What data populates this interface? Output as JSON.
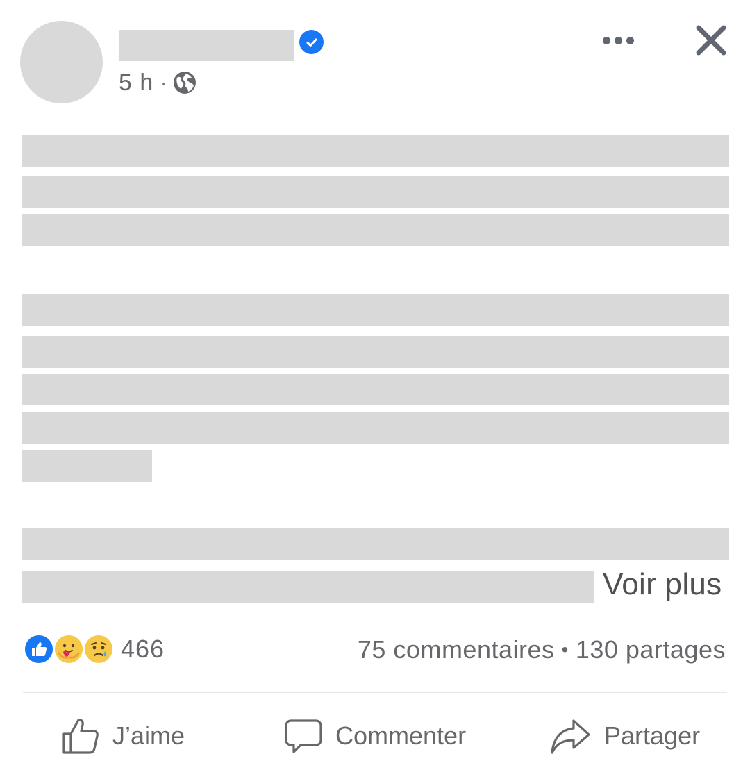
{
  "header": {
    "timestamp": "5 h",
    "separator": "·",
    "audience_icon": "globe-icon",
    "verified_icon": "verified-badge-icon",
    "more_icon": "more-horizontal-icon",
    "close_icon": "close-icon"
  },
  "post": {
    "see_more_label": "Voir plus"
  },
  "reactions": {
    "icons": [
      "like-reaction-icon",
      "care-reaction-icon",
      "sad-reaction-icon"
    ],
    "count": "466",
    "comments": "75 commentaires",
    "separator": "•",
    "shares": "130 partages"
  },
  "actions": {
    "like_label": "J’aime",
    "comment_label": "Commenter",
    "share_label": "Partager"
  },
  "colors": {
    "accent": "#1877f2",
    "secondary_text": "#65676b",
    "redaction": "#d9d9d9"
  }
}
